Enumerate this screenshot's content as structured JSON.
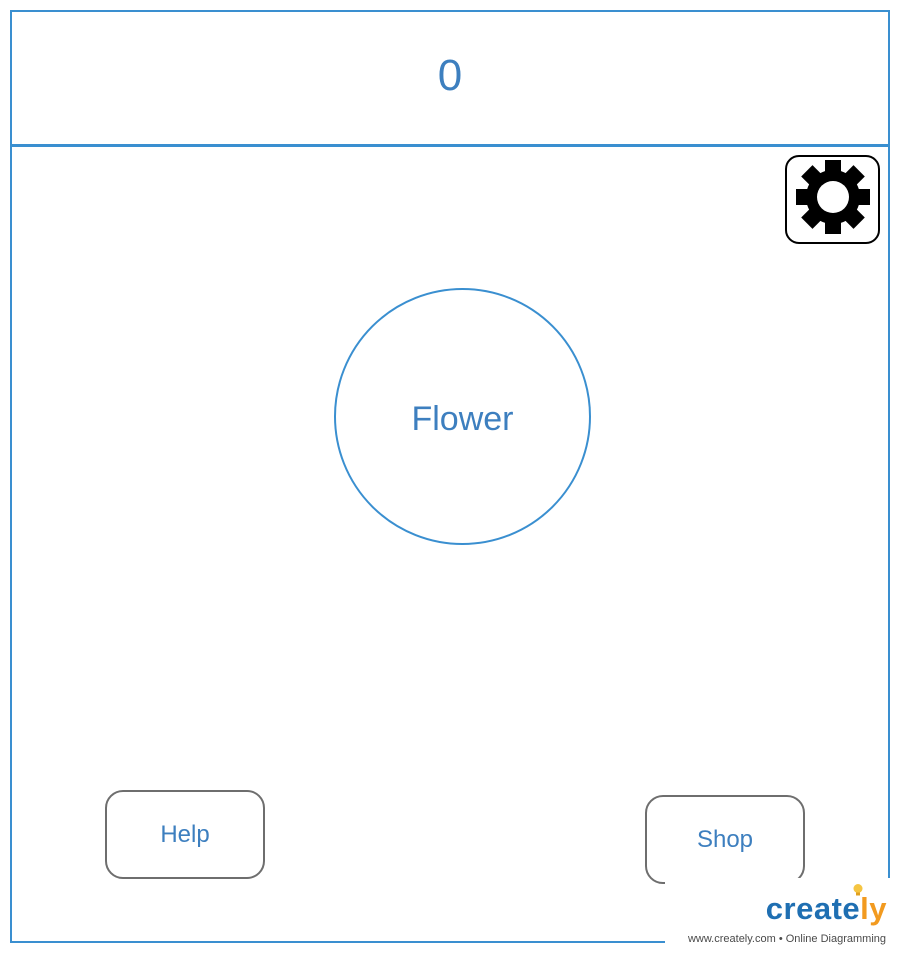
{
  "score": {
    "value": "0"
  },
  "settings": {
    "icon": "gear-icon"
  },
  "flower": {
    "label": "Flower"
  },
  "buttons": {
    "help_label": "Help",
    "shop_label": "Shop"
  },
  "watermark": {
    "brand_main": "create",
    "brand_accent": "ly",
    "tagline": "www.creately.com • Online Diagramming"
  },
  "colors": {
    "accent": "#3a8fd0",
    "text": "#3d7fbf",
    "button_border": "#6e6e6e",
    "brand_blue": "#1f6fb2",
    "brand_orange": "#f29a1f"
  }
}
